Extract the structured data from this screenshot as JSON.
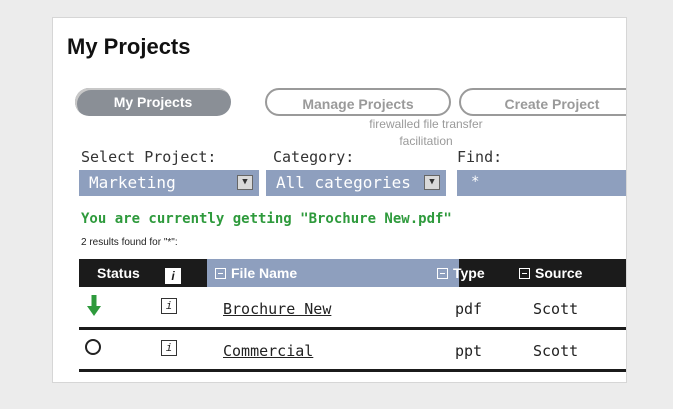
{
  "page": {
    "title": "My Projects"
  },
  "tabs": [
    {
      "label": "My Projects",
      "active": true
    },
    {
      "label": "Manage Projects",
      "active": false
    },
    {
      "label": "Create Project",
      "active": false
    }
  ],
  "tooltip": "firewalled file transfer facilitation",
  "filters": {
    "project_label": "Select Project:",
    "project_value": "Marketing",
    "category_label": "Category:",
    "category_value": "All categories",
    "find_label": "Find:",
    "find_value": "*"
  },
  "status_message": "You are currently getting \"Brochure New.pdf\"",
  "results_text": "2 results found for \"*\":",
  "table": {
    "headers": {
      "status": "Status",
      "info": "i",
      "file_name": "File Name",
      "type": "Type",
      "source": "Source"
    },
    "rows": [
      {
        "status_icon": "download-arrow-icon",
        "file_name": "Brochure New",
        "type": "pdf",
        "source": "Scott"
      },
      {
        "status_icon": "empty-circle-icon",
        "file_name": "Commercial",
        "type": "ppt",
        "source": "Scott"
      }
    ]
  },
  "colors": {
    "accent_blue": "#8e9fbe",
    "status_green": "#2e9a3c",
    "tab_gray": "#8a8f96",
    "header_dark": "#1b1b1b"
  }
}
